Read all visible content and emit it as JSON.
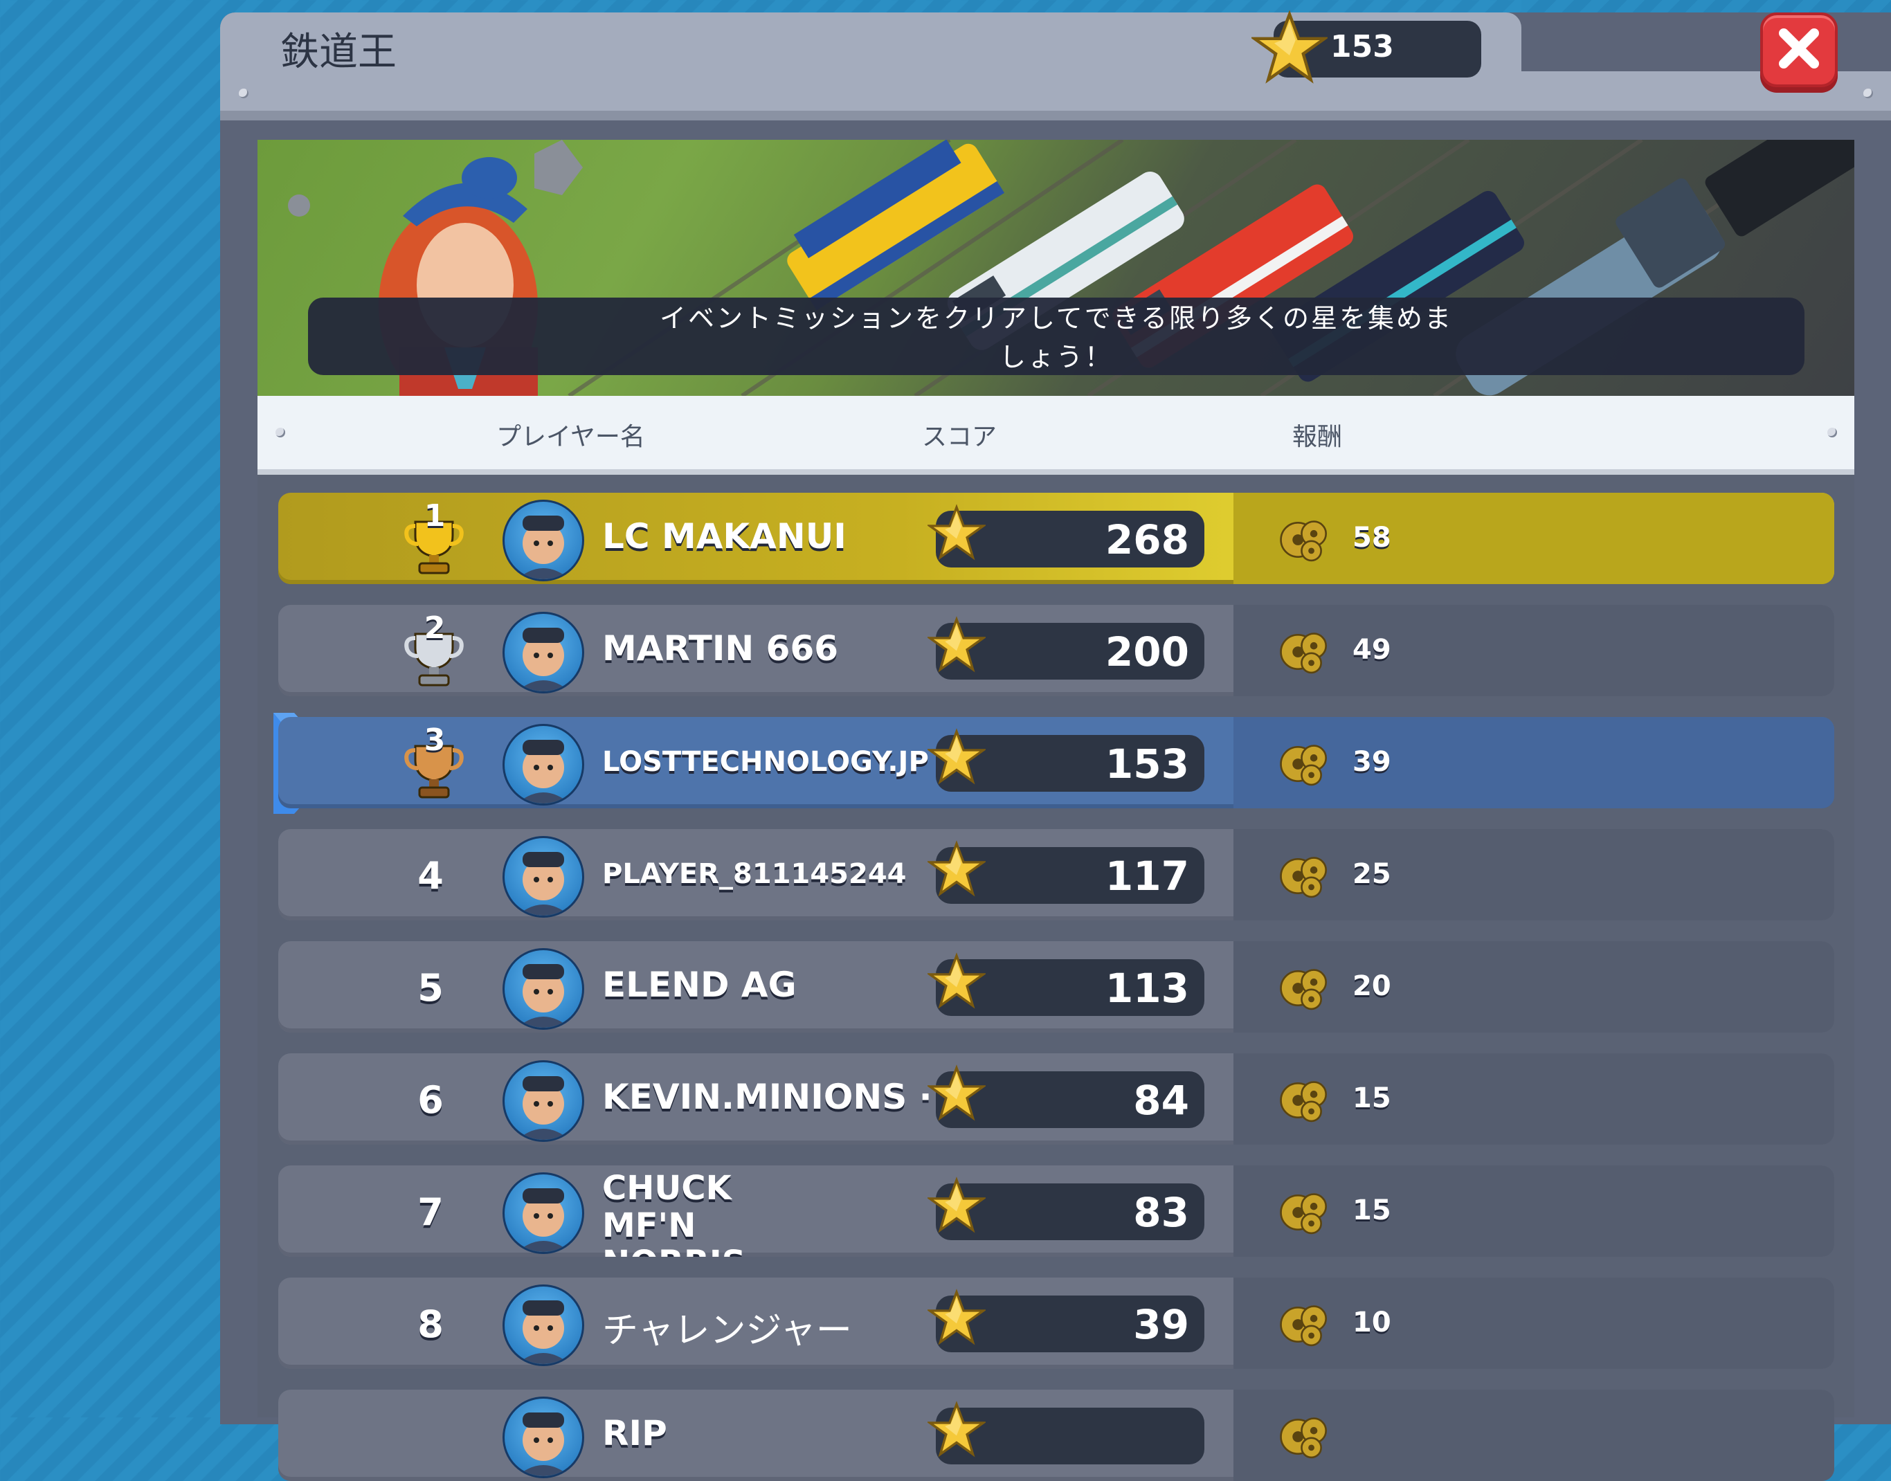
{
  "header": {
    "title": "鉄道王",
    "star_total": "153"
  },
  "banner": {
    "message": "イベントミッションをクリアしてできる限り多くの星を集めま\nしょう！"
  },
  "columns": {
    "player": "プレイヤー名",
    "score": "スコア",
    "reward": "報酬"
  },
  "rows": [
    {
      "rank": "1",
      "name": "LC MAKANUI",
      "score": "268",
      "reward": "58"
    },
    {
      "rank": "2",
      "name": "MARTIN 666",
      "score": "200",
      "reward": "49"
    },
    {
      "rank": "3",
      "name": "LOSTTECHNOLOGY.JP",
      "score": "153",
      "reward": "39"
    },
    {
      "rank": "4",
      "name": "PLAYER_811145244",
      "score": "117",
      "reward": "25"
    },
    {
      "rank": "5",
      "name": "ELEND AG",
      "score": "113",
      "reward": "20"
    },
    {
      "rank": "6",
      "name": "KEVIN.MINIONS ·",
      "score": "84",
      "reward": "15"
    },
    {
      "rank": "7",
      "name": "CHUCK MF'N NORRIS",
      "score": "83",
      "reward": "15"
    },
    {
      "rank": "8",
      "name": "チャレンジャー",
      "score": "39",
      "reward": "10"
    },
    {
      "rank": "",
      "name": "RIP",
      "score": "",
      "reward": ""
    }
  ],
  "icons": {
    "star": "star-icon",
    "gear": "gear-reward-icon",
    "trophy": "trophy-icon",
    "close": "close-icon"
  },
  "colors": {
    "gold_row": "#c7b021",
    "current_player_row": "#4e74ab",
    "close_button": "#e33a3e",
    "panel": "#5c6478"
  }
}
